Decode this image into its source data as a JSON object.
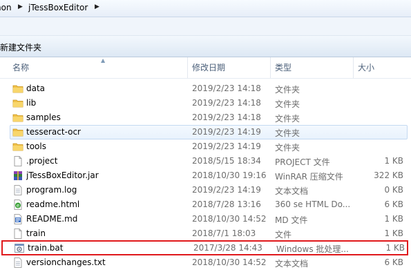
{
  "address_bar": {
    "crumb_partial": "non",
    "crumb_current": "jTessBoxEditor"
  },
  "toolbar": {
    "new_folder_label": "新建文件夹"
  },
  "columns": {
    "name": "名称",
    "date": "修改日期",
    "type": "类型",
    "size": "大小"
  },
  "files": [
    {
      "name": "data",
      "date": "2019/2/23 14:18",
      "type": "文件夹",
      "size": "",
      "icon": "folder-icon"
    },
    {
      "name": "lib",
      "date": "2019/2/23 14:18",
      "type": "文件夹",
      "size": "",
      "icon": "folder-icon"
    },
    {
      "name": "samples",
      "date": "2019/2/23 14:18",
      "type": "文件夹",
      "size": "",
      "icon": "folder-icon"
    },
    {
      "name": "tesseract-ocr",
      "date": "2019/2/23 14:19",
      "type": "文件夹",
      "size": "",
      "icon": "folder-icon"
    },
    {
      "name": "tools",
      "date": "2019/2/23 14:19",
      "type": "文件夹",
      "size": "",
      "icon": "folder-icon"
    },
    {
      "name": ".project",
      "date": "2018/5/15 18:34",
      "type": "PROJECT 文件",
      "size": "1 KB",
      "icon": "blank-file-icon"
    },
    {
      "name": "jTessBoxEditor.jar",
      "date": "2018/10/30 19:16",
      "type": "WinRAR 压缩文件",
      "size": "322 KB",
      "icon": "winrar-archive-icon"
    },
    {
      "name": "program.log",
      "date": "2019/2/23 14:19",
      "type": "文本文档",
      "size": "0 KB",
      "icon": "text-file-icon"
    },
    {
      "name": "readme.html",
      "date": "2018/7/28 13:16",
      "type": "360 se HTML Do...",
      "size": "6 KB",
      "icon": "browser-html-icon"
    },
    {
      "name": "README.md",
      "date": "2018/10/30 14:52",
      "type": "MD 文件",
      "size": "1 KB",
      "icon": "md-file-icon"
    },
    {
      "name": "train",
      "date": "2018/7/1 18:03",
      "type": "文件",
      "size": "1 KB",
      "icon": "blank-file-icon"
    },
    {
      "name": "train.bat",
      "date": "2017/3/28 14:43",
      "type": "Windows 批处理...",
      "size": "1 KB",
      "icon": "batch-gear-icon"
    },
    {
      "name": "versionchanges.txt",
      "date": "2018/10/30 14:52",
      "type": "文本文档",
      "size": "6 KB",
      "icon": "text-file-icon"
    }
  ],
  "colors": {
    "highlight_border": "#e0181b",
    "hover_row": "#e8f2fd",
    "secondary_text": "#6d6d6d",
    "folder_yellow": "#f1c24b"
  }
}
